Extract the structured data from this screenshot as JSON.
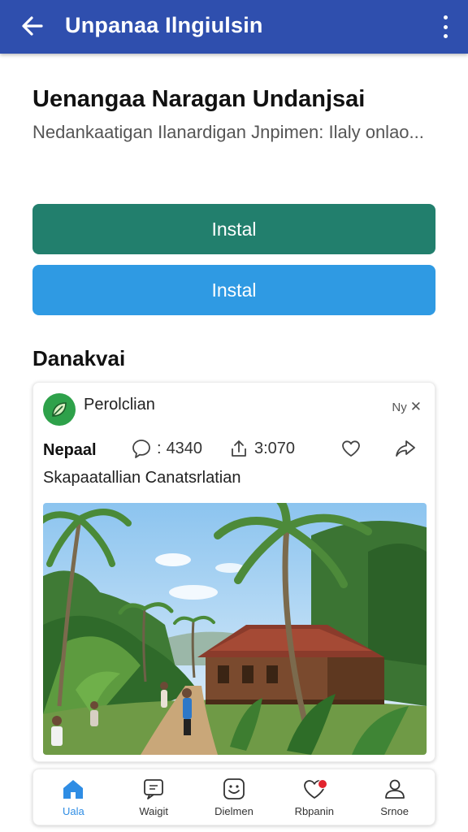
{
  "app_bar": {
    "title": "Unpanaa Ilngiulsin"
  },
  "headline": "Uenangaa Naragan Undanjsai",
  "description": "Nedankaatigan Ilanardigan Jnpimen: Ilaly onlao...",
  "buttons": {
    "primary_label": "Instal",
    "secondary_label": "Instal"
  },
  "section_title": "Danakvai",
  "post": {
    "author": "Perolclian",
    "corner_text": "Ny",
    "location": "Nepaal",
    "comments_count": "4340",
    "shares_count": "3:070",
    "caption": "Skapaatallian Canatsrlatian"
  },
  "bottom_nav": {
    "items": [
      {
        "label": "Uala",
        "icon": "home-icon",
        "active": true
      },
      {
        "label": "Waigit",
        "icon": "message-icon",
        "active": false
      },
      {
        "label": "Dielmen",
        "icon": "smile-icon",
        "active": false
      },
      {
        "label": "Rbpanin",
        "icon": "heart-icon",
        "active": false
      },
      {
        "label": "Srnoe",
        "icon": "profile-icon",
        "active": false
      }
    ]
  },
  "colors": {
    "app_bar": "#2f4fae",
    "primary_button": "#227f6d",
    "secondary_button": "#2f9ae3",
    "active_nav": "#2f8de4",
    "badge": "#e2242e"
  }
}
